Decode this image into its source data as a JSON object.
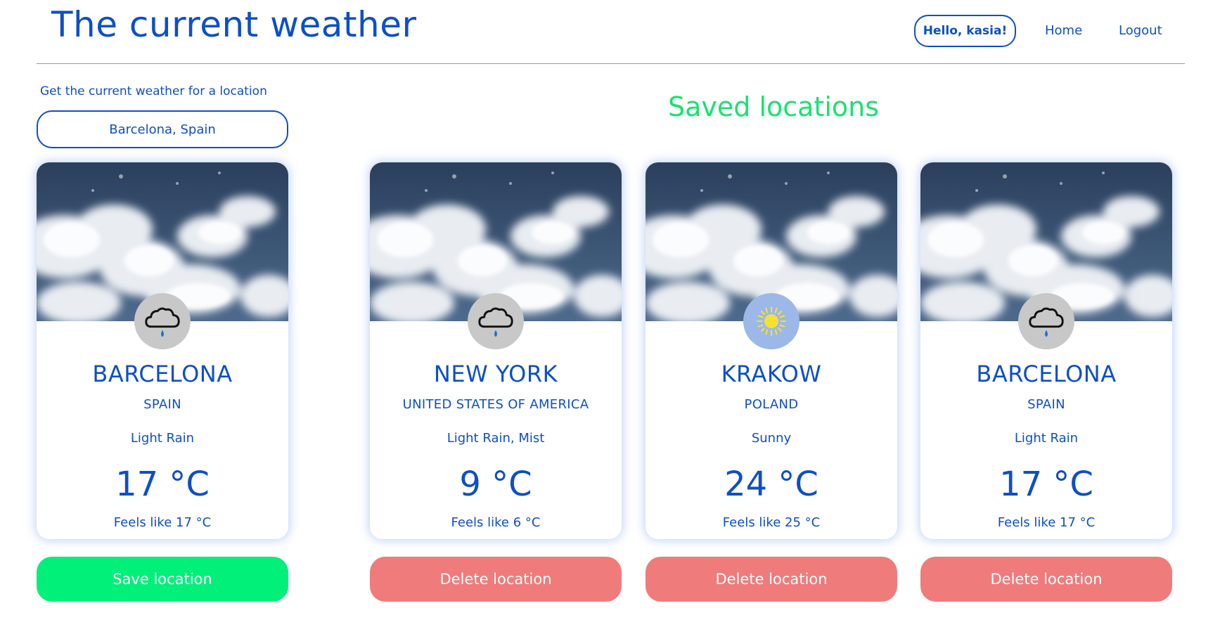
{
  "header": {
    "title": "The current weather",
    "greeting": "Hello, kasia!",
    "nav_home": "Home",
    "nav_logout": "Logout"
  },
  "search": {
    "label": "Get the current weather for a location",
    "value": "Barcelona, Spain"
  },
  "saved_title": "Saved locations",
  "current_card": {
    "city": "BARCELONA",
    "country": "SPAIN",
    "condition": "Light Rain",
    "temperature": "17 °C",
    "feels_like": "Feels like 17 °C",
    "icon": "rain-cloud-icon",
    "button": "Save location"
  },
  "saved_cards": [
    {
      "city": "NEW YORK",
      "country": "UNITED STATES OF AMERICA",
      "condition": "Light Rain, Mist",
      "temperature": "9 °C",
      "feels_like": "Feels like 6 °C",
      "icon": "rain-cloud-icon",
      "button": "Delete location"
    },
    {
      "city": "KRAKOW",
      "country": "POLAND",
      "condition": "Sunny",
      "temperature": "24 °C",
      "feels_like": "Feels like 25 °C",
      "icon": "sun-icon",
      "button": "Delete location"
    },
    {
      "city": "BARCELONA",
      "country": "SPAIN",
      "condition": "Light Rain",
      "temperature": "17 °C",
      "feels_like": "Feels like 17 °C",
      "icon": "rain-cloud-icon",
      "button": "Delete location"
    }
  ],
  "colors": {
    "primary": "#0d4fc7",
    "accent_green": "#18e36f",
    "save_button": "#00f07a",
    "delete_button": "#ef7b7b",
    "sky_dark": "#2b4463"
  }
}
